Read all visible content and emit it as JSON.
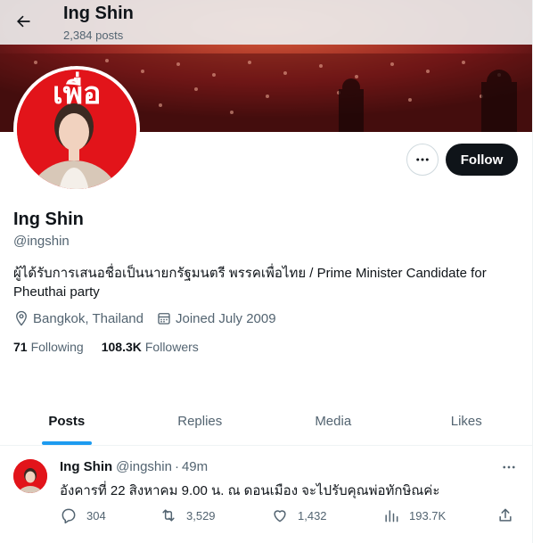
{
  "header": {
    "title": "Ing Shin",
    "post_count": "2,384 posts"
  },
  "profile": {
    "name": "Ing Shin",
    "handle": "@ingshin",
    "bio": "ผู้ได้รับการเสนอชื่อเป็นนายกรัฐมนตรี พรรคเพื่อไทย / Prime Minister Candidate for Pheuthai party",
    "location": "Bangkok, Thailand",
    "joined": "Joined July 2009",
    "following_count": "71",
    "following_label": "Following",
    "followers_count": "108.3K",
    "followers_label": "Followers",
    "follow_button": "Follow",
    "avatar_text": "เพื่อ"
  },
  "tabs": [
    {
      "label": "Posts",
      "active": true
    },
    {
      "label": "Replies",
      "active": false
    },
    {
      "label": "Media",
      "active": false
    },
    {
      "label": "Likes",
      "active": false
    }
  ],
  "tweet": {
    "name": "Ing Shin",
    "handle": "@ingshin",
    "separator": "·",
    "time": "49m",
    "text": "อังคารที่ 22 สิงหาคม 9.00 น. ณ ดอนเมือง จะไปรับคุณพ่อทักษิณค่ะ",
    "replies": "304",
    "reposts": "3,529",
    "likes": "1,432",
    "views": "193.7K"
  },
  "icons": {
    "back": "arrow-left-icon",
    "more": "more-horizontal-icon",
    "location": "location-pin-icon",
    "calendar": "calendar-icon",
    "reply": "reply-icon",
    "repost": "repost-icon",
    "like": "heart-icon",
    "views": "views-chart-icon",
    "share": "share-icon"
  },
  "colors": {
    "accent": "#1d9bf0",
    "text": "#0f1419",
    "muted": "#536471",
    "brand_red": "#e2141a"
  }
}
